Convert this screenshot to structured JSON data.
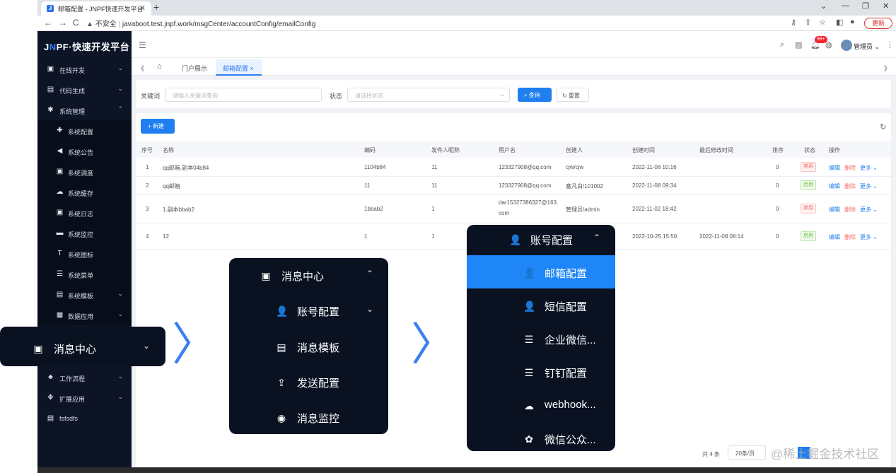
{
  "browser": {
    "tab_title": "邮箱配置 - JNPF快速开发平台",
    "tab_favicon": "J",
    "new_tab": "+",
    "nav": {
      "back": "←",
      "forward": "→",
      "reload": "C"
    },
    "insecure_label": "不安全",
    "url": "javaboot.test.jnpf.work/msgCenter/accountConfig/emailConfig",
    "update_label": "更新",
    "window_controls": [
      "⌄",
      "—",
      "❐",
      "✕"
    ]
  },
  "app": {
    "logo_left": "J",
    "logo_o": "N",
    "logo_right": "PF·快速开发平台",
    "badge": "99+",
    "user": "管理员",
    "sidebar": {
      "items": [
        {
          "label": "在线开发",
          "icon": "monitor-icon",
          "glyph": "▣",
          "arrow": "⌄"
        },
        {
          "label": "代码生成",
          "icon": "code-icon",
          "glyph": "▤",
          "arrow": "⌄"
        },
        {
          "label": "系统管理",
          "icon": "gear-icon",
          "glyph": "✱",
          "arrow": "⌃"
        },
        {
          "label": "系统配置",
          "icon": "config-icon",
          "glyph": "✚"
        },
        {
          "label": "系统公告",
          "icon": "announce-icon",
          "glyph": "◀"
        },
        {
          "label": "系统调度",
          "icon": "schedule-icon",
          "glyph": "▣"
        },
        {
          "label": "系统缓存",
          "icon": "cloud-icon",
          "glyph": "☁"
        },
        {
          "label": "系统日志",
          "icon": "log-icon",
          "glyph": "▣"
        },
        {
          "label": "系统监控",
          "icon": "monitor-chart-icon",
          "glyph": "▬"
        },
        {
          "label": "系统图标",
          "icon": "icon-lib-icon",
          "glyph": "T"
        },
        {
          "label": "系统菜单",
          "icon": "menu-icon",
          "glyph": "☰"
        },
        {
          "label": "系统模板",
          "icon": "template-icon",
          "glyph": "▤",
          "arrow": "⌄"
        },
        {
          "label": "数据应用",
          "icon": "data-icon",
          "glyph": "▦",
          "arrow": "⌄"
        },
        {
          "label": "工作流程",
          "icon": "workflow-icon",
          "glyph": "♣",
          "arrow": "⌄"
        },
        {
          "label": "扩展应用",
          "icon": "extend-icon",
          "glyph": "✥",
          "arrow": "⌄"
        },
        {
          "label": "fsfsdfs",
          "icon": "file-icon",
          "glyph": "▤"
        }
      ]
    },
    "tabs": {
      "collapse": "《",
      "home": "⌂",
      "portal": "门户展示",
      "active": "邮箱配置 ×",
      "expand": "》"
    },
    "search": {
      "keyword_label": "关键词",
      "keyword_placeholder": "请输入关键词查询",
      "status_label": "状态",
      "status_placeholder": "请选择状态",
      "query_button": "⌕ 查询",
      "reset_button": "↻ 重置"
    },
    "toolbar": {
      "new_button": "+ 新建",
      "refresh": "↻"
    },
    "table": {
      "headers": [
        "序号",
        "名称",
        "编码",
        "发件人昵称",
        "用户名",
        "创建人",
        "创建时间",
        "最后修改时间",
        "排序",
        "状态",
        "操作"
      ],
      "rows": [
        {
          "no": "1",
          "name": "qq邮箱.副本04b84",
          "code": "1104b84",
          "sender": "11",
          "user": "123327908@qq.com",
          "user2": "",
          "creator": "cjw/cjw",
          "created": "2022-11-08 10:16",
          "modified": "",
          "sort": "0",
          "status": "禁用",
          "active": false
        },
        {
          "no": "2",
          "name": "qq邮箱",
          "code": "11",
          "sender": "11",
          "user": "123327908@qq.com",
          "user2": "",
          "creator": "塞凡白/101002",
          "created": "2022-11-08 09:34",
          "modified": "",
          "sort": "0",
          "status": "启用",
          "active": true
        },
        {
          "no": "3",
          "name": "1.副本bbab2",
          "code": "1bbab2",
          "sender": "1",
          "user": "dar15327386327@163.",
          "user2": "com",
          "creator": "管理员/admin",
          "created": "2022-11-02 18:42",
          "modified": "",
          "sort": "0",
          "status": "禁用",
          "active": false
        },
        {
          "no": "4",
          "name": "12",
          "code": "1",
          "sender": "1",
          "user": "",
          "user2": "",
          "creator": "",
          "created": "2022-10-25 15:50",
          "modified": "2022-11-08 08:14",
          "sort": "0",
          "status": "启用",
          "active": true
        }
      ],
      "op_edit": "编辑",
      "op_delete": "删除",
      "op_more": "更多 ⌄"
    },
    "pager": {
      "total": "共 4 条",
      "size": "20条/页"
    }
  },
  "overlay": {
    "menu1": {
      "icon": "message-icon",
      "glyph": "▣",
      "label": "消息中心",
      "arrow": "⌄"
    },
    "menu2": {
      "title": {
        "glyph": "▣",
        "label": "消息中心",
        "arrow": "⌃"
      },
      "items": [
        {
          "glyph": "👤",
          "label": "账号配置",
          "arrow": "⌄"
        },
        {
          "glyph": "▤",
          "label": "消息模板"
        },
        {
          "glyph": "⇪",
          "label": "发送配置"
        },
        {
          "glyph": "◉",
          "label": "消息监控"
        }
      ]
    },
    "menu3": {
      "title": {
        "glyph": "👤",
        "label": "账号配置",
        "arrow": "⌃"
      },
      "items": [
        {
          "glyph": "👤",
          "label": "邮箱配置",
          "selected": true
        },
        {
          "glyph": "👤",
          "label": "短信配置"
        },
        {
          "glyph": "☰",
          "label": "企业微信..."
        },
        {
          "glyph": "☰",
          "label": "钉钉配置"
        },
        {
          "glyph": "☁",
          "label": "webhook..."
        },
        {
          "glyph": "✿",
          "label": "微信公众..."
        }
      ]
    },
    "arrow": "〉"
  },
  "watermark": "@稀土掘金技术社区",
  "colors": {
    "sidebar": "#0c1426",
    "primary": "#1f7ff0",
    "arrow": "#3b7ff0"
  }
}
